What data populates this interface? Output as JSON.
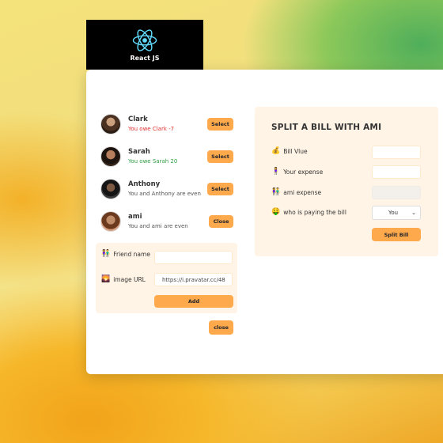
{
  "logo": {
    "text": "React JS",
    "icon": "react-atom-icon",
    "color": "#61dafb"
  },
  "friends": [
    {
      "name": "Clark",
      "status": "You owe Clark -7",
      "status_type": "owe",
      "button": "Select"
    },
    {
      "name": "Sarah",
      "status": "You owe Sarah 20",
      "status_type": "owed",
      "button": "Select"
    },
    {
      "name": "Anthony",
      "status": "You and Anthony are even",
      "status_type": "even",
      "button": "Select"
    },
    {
      "name": "ami",
      "status": "You and ami are even",
      "status_type": "even",
      "button": "Close"
    }
  ],
  "add_form": {
    "friend_name_emoji": "👫",
    "friend_name_label": "Friend name",
    "friend_name_value": "",
    "image_url_emoji": "🌄",
    "image_url_label": "image URL",
    "image_url_value": "https://i.pravatar.cc/48",
    "add_button": "Add"
  },
  "close_button": "close",
  "split": {
    "title": "SPLIT A BILL WITH AMI",
    "bill_emoji": "💰",
    "bill_label": "Bill Vlue",
    "bill_value": "",
    "expense_emoji": "🧍‍♀️",
    "expense_label": "Your expense",
    "expense_value": "",
    "friend_emoji": "👫",
    "friend_expense_label": "ami expense",
    "friend_expense_value": "",
    "payer_emoji": "🤑",
    "payer_label": "who is paying the bill",
    "payer_selected": "You",
    "split_button": "Split Bill"
  },
  "colors": {
    "accent": "#ffa94d",
    "panel": "#fff4e6",
    "owe": "#e03131",
    "owed": "#2f9e44"
  }
}
